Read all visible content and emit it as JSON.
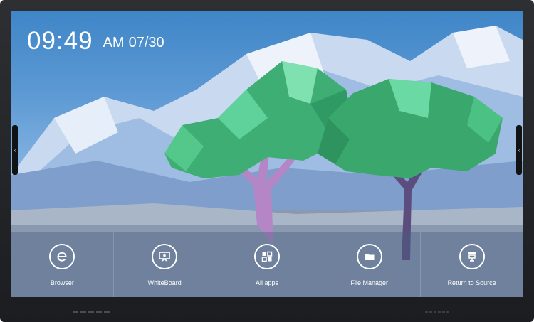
{
  "clock": {
    "time": "09:49",
    "ampm": "AM",
    "date": "07/30"
  },
  "dock": {
    "items": [
      {
        "label": "Browser",
        "icon": "browser-icon"
      },
      {
        "label": "WhiteBoard",
        "icon": "whiteboard-icon"
      },
      {
        "label": "All apps",
        "icon": "apps-grid-icon"
      },
      {
        "label": "File Manager",
        "icon": "folder-icon"
      },
      {
        "label": "Return to Source",
        "icon": "return-to-source-icon"
      }
    ]
  },
  "side_tabs": {
    "left_glyph": "‹",
    "right_glyph": "‹"
  },
  "colors": {
    "bezel": "#1c1d20",
    "sky": "#5e9ad4",
    "foliage": "#4cc686",
    "trunk": "#b586c6"
  }
}
